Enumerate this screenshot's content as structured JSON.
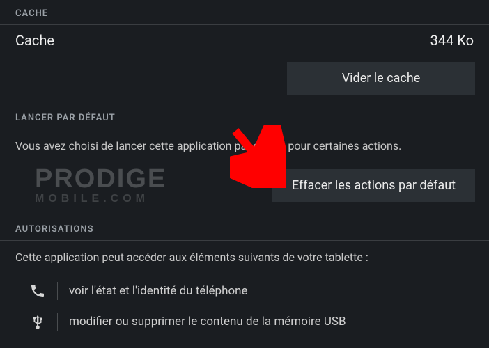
{
  "sections": {
    "cache": {
      "header": "CACHE",
      "label": "Cache",
      "value": "344 Ko",
      "clear_button": "Vider le cache"
    },
    "launch_default": {
      "header": "LANCER PAR DÉFAUT",
      "description": "Vous avez choisi de lancer cette application par défaut pour certaines actions.",
      "clear_button": "Effacer les actions par défaut"
    },
    "permissions": {
      "header": "AUTORISATIONS",
      "description": "Cette application peut accéder aux éléments suivants de votre tablette :",
      "items": [
        {
          "icon": "phone",
          "text": "voir l'état et l'identité du téléphone"
        },
        {
          "icon": "usb",
          "text": "modifier ou supprimer le contenu de la mémoire USB"
        }
      ]
    }
  },
  "watermark": {
    "line1": "PRODIGE",
    "line2": "MOBILE.COM"
  }
}
